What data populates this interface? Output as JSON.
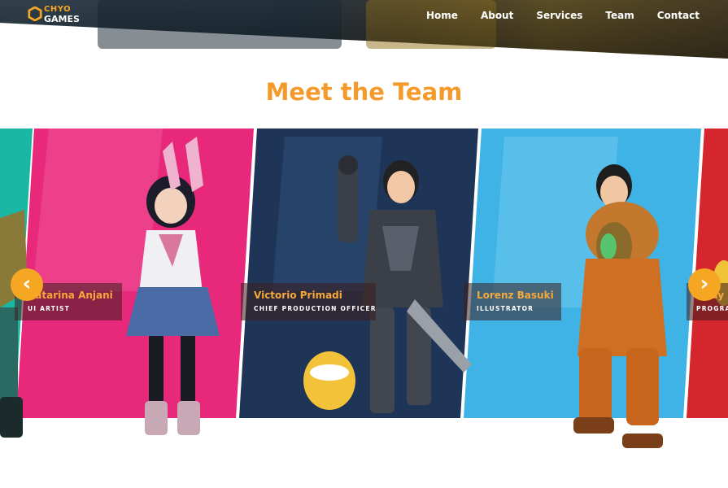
{
  "logo": {
    "top": "CHYO",
    "bottom": "GAMES"
  },
  "nav": [
    "Home",
    "About",
    "Services",
    "Team",
    "Contact"
  ],
  "title": "Meet the Team",
  "team": [
    {
      "name": "Katarina Anjani",
      "role": "UI ARTIST"
    },
    {
      "name": "Victorio Primadi",
      "role": "CHIEF PRODUCTION OFFICER"
    },
    {
      "name": "Lorenz Basuki",
      "role": "ILLUSTRATOR"
    },
    {
      "name": "Andy",
      "role": "PROGRA"
    }
  ],
  "colors": {
    "accent": "#f39a2b",
    "pink": "#e8287a",
    "navy": "#1f3558",
    "sky": "#3fb3e6",
    "red": "#d6262d",
    "teal": "#1ab7a4"
  },
  "icons": {
    "prev": "chevron-left-icon",
    "next": "chevron-right-icon",
    "logo": "hexagon-logo-icon"
  },
  "arrows": {
    "prev": "‹",
    "next": "›"
  }
}
